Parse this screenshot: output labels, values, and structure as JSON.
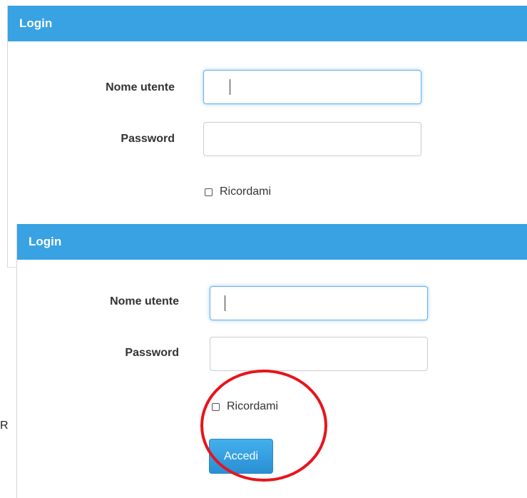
{
  "back_panel": {
    "title": "Login",
    "username_label": "Nome utente",
    "username_value": "",
    "password_label": "Password",
    "password_value": "",
    "remember_label": "Ricordami"
  },
  "front_panel": {
    "title": "Login",
    "username_label": "Nome utente",
    "username_value": "",
    "password_label": "Password",
    "password_value": "",
    "remember_label": "Ricordami",
    "submit_label": "Accedi"
  },
  "stray_text": "R",
  "colors": {
    "heading_bg": "#38a2e2",
    "button_bg": "#2a8fd4",
    "annotation_red": "#e8141b",
    "focus_border": "#66afe9"
  },
  "icons": {
    "checkbox": "unchecked-checkbox-icon"
  }
}
